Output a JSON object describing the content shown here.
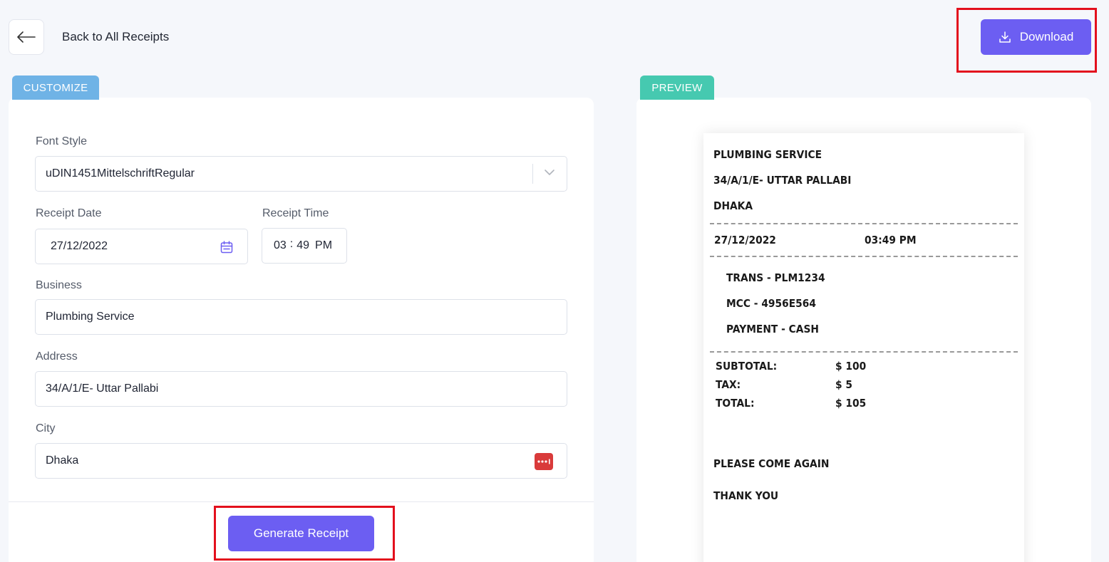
{
  "header": {
    "back_label": "Back to All Receipts",
    "download_label": "Download"
  },
  "tabs": {
    "customize": "CUSTOMIZE",
    "preview": "PREVIEW"
  },
  "form": {
    "font_style": {
      "label": "Font Style",
      "value": "uDIN1451MittelschriftRegular"
    },
    "receipt_date": {
      "label": "Receipt Date",
      "value": "27/12/2022"
    },
    "receipt_time": {
      "label": "Receipt Time",
      "hour": "03",
      "sep": ":",
      "minute": "49",
      "ampm": "PM"
    },
    "business": {
      "label": "Business",
      "value": "Plumbing Service"
    },
    "address": {
      "label": "Address",
      "value": "34/A/1/E- Uttar Pallabi"
    },
    "city": {
      "label": "City",
      "value": "Dhaka"
    },
    "generate_label": "Generate Receipt"
  },
  "receipt": {
    "business": "PLUMBING SERVICE",
    "address": "34/A/1/E- UTTAR PALLABI",
    "city": "DHAKA",
    "date": "27/12/2022",
    "time": "03:49 PM",
    "trans": "TRANS - PLM1234",
    "mcc": "MCC - 4956E564",
    "payment": "PAYMENT - CASH",
    "subtotal_label": "SUBTOTAL:",
    "subtotal_value": "$ 100",
    "tax_label": "TAX:",
    "tax_value": "$ 5",
    "total_label": "TOTAL:",
    "total_value": "$ 105",
    "footer1": "PLEASE COME AGAIN",
    "footer2": "THANK YOU"
  },
  "colors": {
    "primary": "#6c5ef2",
    "customize_tab": "#6fb3e6",
    "preview_tab": "#46c9b0",
    "highlight": "#e3101d"
  },
  "icons": {
    "back": "arrow-left-icon",
    "download": "download-icon",
    "calendar": "calendar-icon",
    "chevron": "chevron-down-icon",
    "password_manager": "password-manager-icon"
  }
}
